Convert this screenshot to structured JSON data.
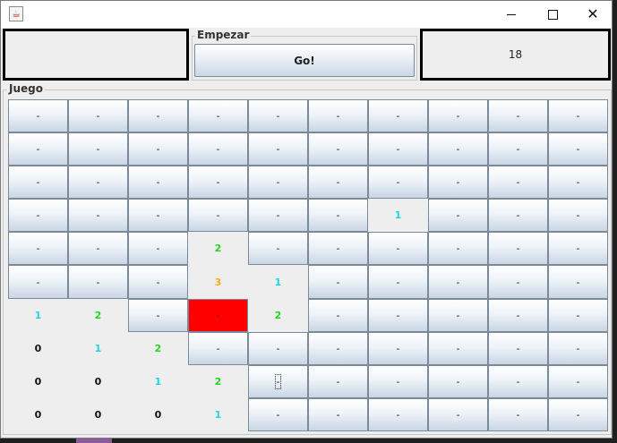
{
  "window": {
    "icon": "java-app-icon",
    "controls": {
      "minimize": "minimize-icon",
      "maximize": "maximize-icon",
      "close": "✕"
    }
  },
  "header": {
    "left_panel_text": "",
    "start_group_title": "Empezar",
    "go_label": "Go!",
    "counter": "18"
  },
  "game": {
    "title": "Juego",
    "rows": [
      [
        "-",
        "-",
        "-",
        "-",
        "-",
        "-",
        "-",
        "-",
        "-",
        "-"
      ],
      [
        "-",
        "-",
        "-",
        "-",
        "-",
        "-",
        "-",
        "-",
        "-",
        "-"
      ],
      [
        "-",
        "-",
        "-",
        "-",
        "-",
        "-",
        "-",
        "-",
        "-",
        "-"
      ],
      [
        "-",
        "-",
        "-",
        "-",
        "-",
        "-",
        "1",
        "-",
        "-",
        "-"
      ],
      [
        "-",
        "-",
        "-",
        "2",
        "-",
        "-",
        "-",
        "-",
        "-",
        "-"
      ],
      [
        "-",
        "-",
        "-",
        "3",
        "1",
        "-",
        "-",
        "-",
        "-",
        "-"
      ],
      [
        "1",
        "2",
        "-",
        "-",
        "2",
        "-",
        "-",
        "-",
        "-",
        "-"
      ],
      [
        "0",
        "1",
        "2",
        "-",
        "-",
        "-",
        "-",
        "-",
        "-",
        "-"
      ],
      [
        "0",
        "0",
        "1",
        "2",
        "-",
        "-",
        "-",
        "-",
        "-",
        "-"
      ],
      [
        "0",
        "0",
        "0",
        "1",
        "-",
        "-",
        "-",
        "-",
        "-",
        "-"
      ]
    ],
    "opened": [
      [
        3,
        6
      ],
      [
        4,
        3
      ],
      [
        5,
        3
      ],
      [
        5,
        4
      ],
      [
        6,
        0
      ],
      [
        6,
        1
      ],
      [
        6,
        4
      ],
      [
        7,
        0
      ],
      [
        7,
        1
      ],
      [
        7,
        2
      ],
      [
        8,
        0
      ],
      [
        8,
        1
      ],
      [
        8,
        2
      ],
      [
        8,
        3
      ],
      [
        9,
        0
      ],
      [
        9,
        1
      ],
      [
        9,
        2
      ],
      [
        9,
        3
      ]
    ],
    "exploded": [
      6,
      3
    ],
    "focused": [
      8,
      4
    ],
    "colors": {
      "0": "#111111",
      "1": "#22d4dd",
      "2": "#22d422",
      "3": "#e8b018",
      "hidden": "#222222",
      "mine": "#ff0000"
    }
  }
}
